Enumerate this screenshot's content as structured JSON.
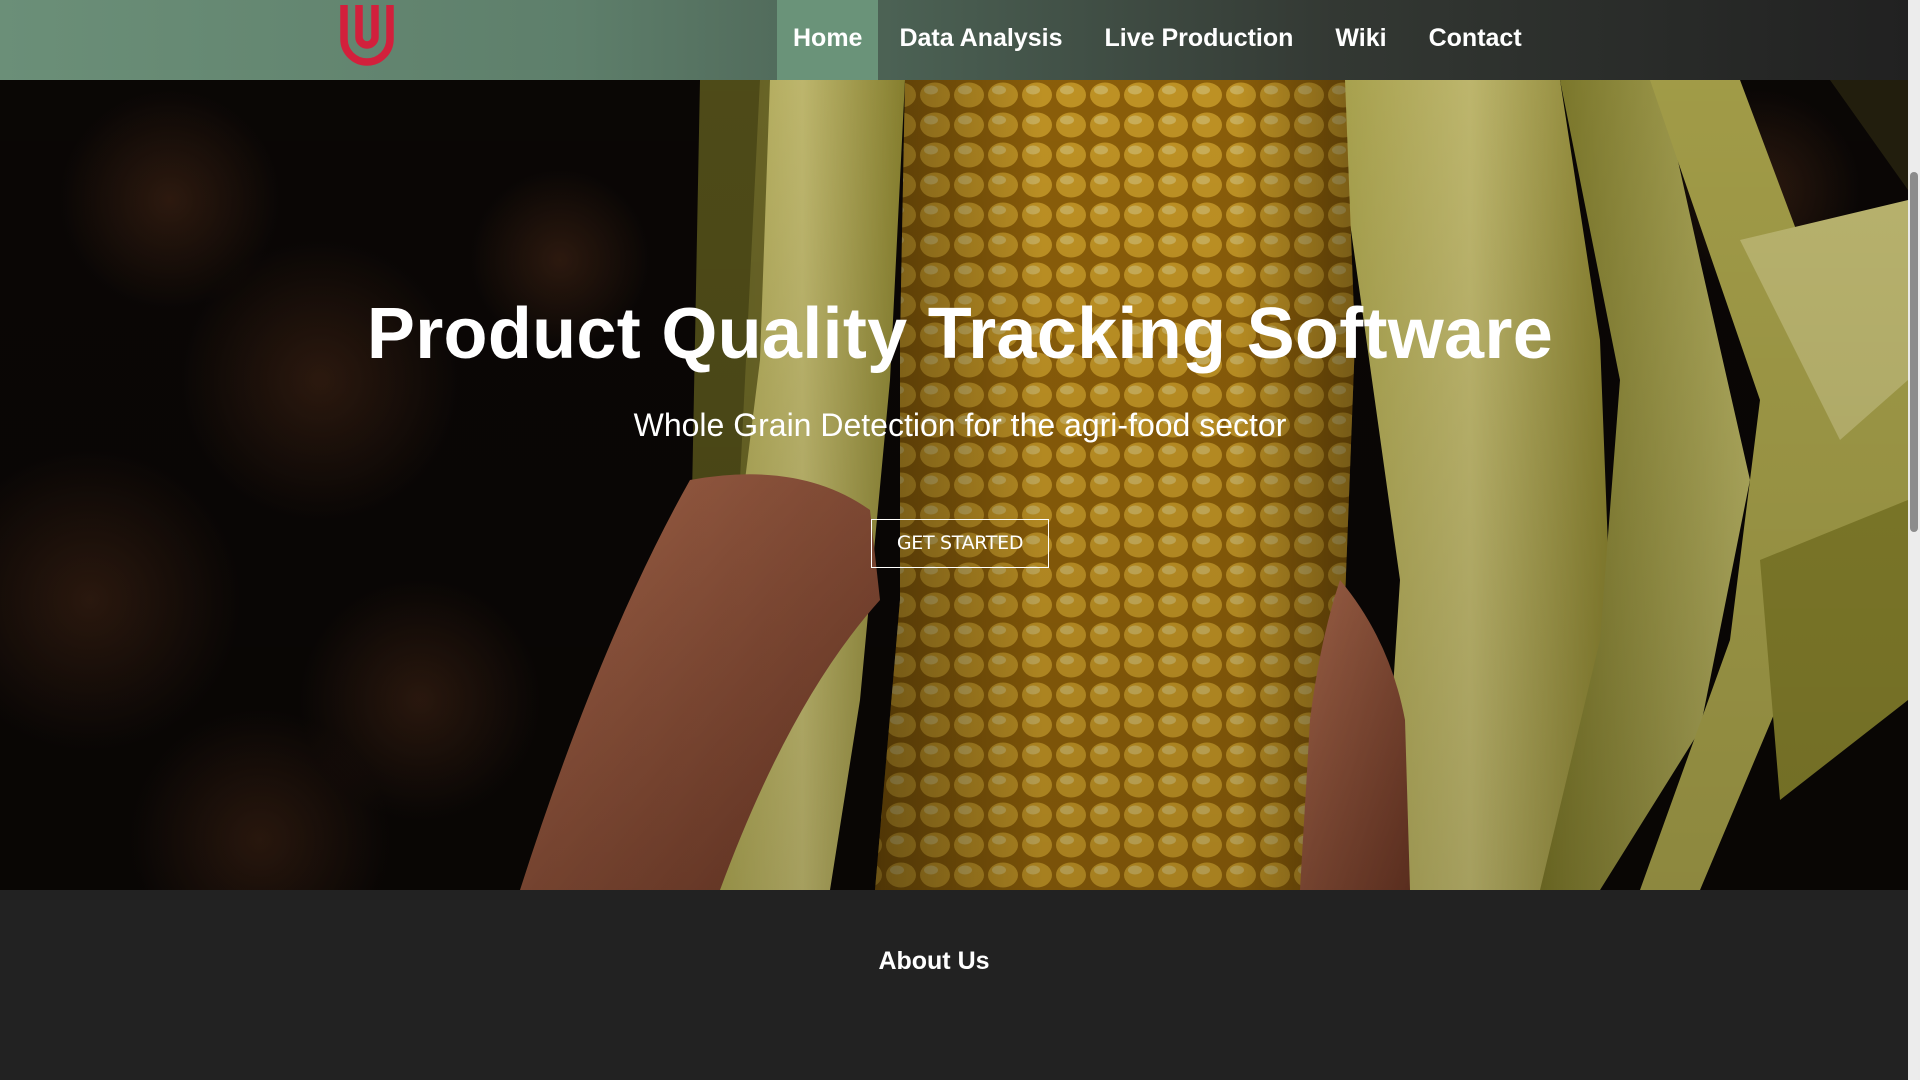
{
  "nav": {
    "logo": {
      "icon": "u-logo-icon",
      "color": "#d2203c"
    },
    "items": [
      {
        "label": "Home",
        "active": true
      },
      {
        "label": "Data Analysis",
        "active": false
      },
      {
        "label": "Live Production",
        "active": false
      },
      {
        "label": "Wiki",
        "active": false
      },
      {
        "label": "Contact",
        "active": false
      }
    ]
  },
  "hero": {
    "title": "Product Quality Tracking Software",
    "subtitle": "Whole Grain Detection for the agri-food sector",
    "cta_label": "GET STARTED"
  },
  "about": {
    "heading": "About Us"
  },
  "colors": {
    "nav_active": "#6a9379",
    "section_bg": "#222222",
    "logo_red": "#d2203c"
  }
}
